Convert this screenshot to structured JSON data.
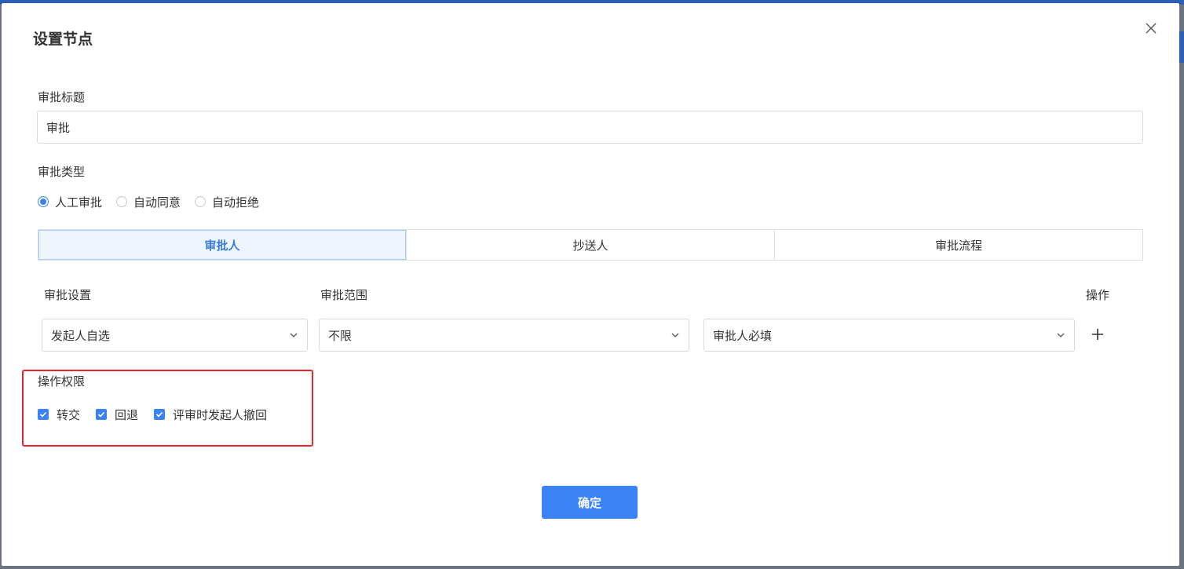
{
  "dialog": {
    "title": "设置节点"
  },
  "approval_title": {
    "label": "审批标题",
    "value": "审批"
  },
  "approval_type": {
    "label": "审批类型",
    "options": [
      {
        "label": "人工审批",
        "checked": true
      },
      {
        "label": "自动同意",
        "checked": false
      },
      {
        "label": "自动拒绝",
        "checked": false
      }
    ]
  },
  "tabs": [
    {
      "label": "审批人",
      "active": true
    },
    {
      "label": "抄送人",
      "active": false
    },
    {
      "label": "审批流程",
      "active": false
    }
  ],
  "approver_table": {
    "headers": {
      "setting": "审批设置",
      "scope": "审批范围",
      "action": "操作"
    },
    "row": {
      "setting_value": "发起人自选",
      "scope_value": "不限",
      "required_value": "审批人必填"
    }
  },
  "permissions": {
    "label": "操作权限",
    "items": [
      {
        "label": "转交",
        "checked": true
      },
      {
        "label": "回退",
        "checked": true
      },
      {
        "label": "评审时发起人撤回",
        "checked": true
      }
    ]
  },
  "footer": {
    "confirm_label": "确定"
  },
  "colors": {
    "accent": "#3b82f6",
    "highlight_border": "#e8262b"
  },
  "icons": {
    "close": "close-icon",
    "chevron": "chevron-down-icon",
    "plus": "plus-icon",
    "check": "check-icon"
  }
}
